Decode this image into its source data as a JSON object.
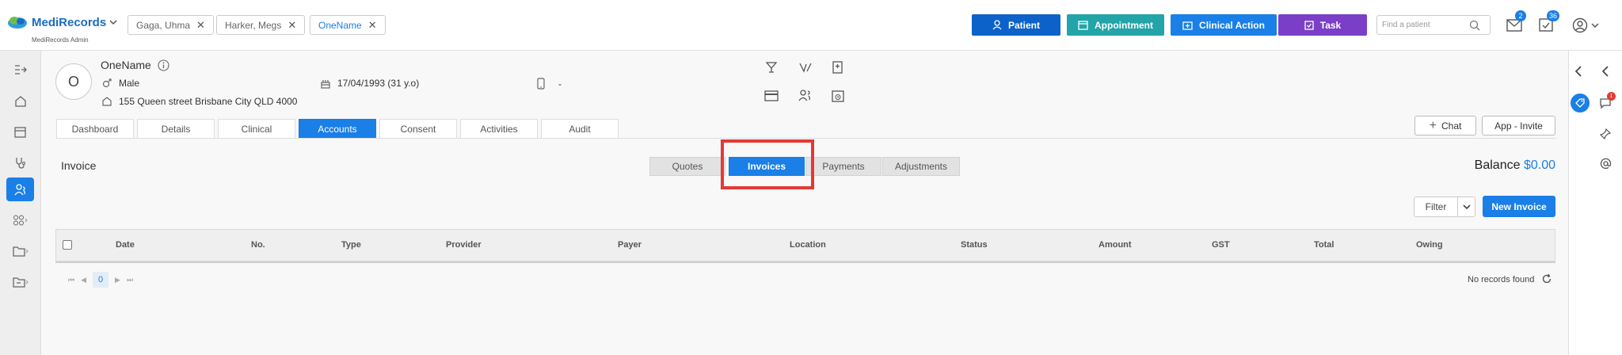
{
  "app": {
    "brand": "MediRecords",
    "subtitle": "MediRecords Admin",
    "colors": {
      "primary": "#1a7fe6",
      "patient": "#0d62c9",
      "appointment": "#22a4a8",
      "clinical": "#1a7fe6",
      "task": "#7b3fc7",
      "highlight": "#e53935"
    }
  },
  "open_patients": [
    {
      "label": "Gaga, Uhma"
    },
    {
      "label": "Harker, Megs"
    },
    {
      "label": "OneName"
    }
  ],
  "actions": {
    "patient": "Patient",
    "appointment": "Appointment",
    "clinical": "Clinical Action",
    "task": "Task"
  },
  "search": {
    "placeholder": "Find a patient"
  },
  "notifications": {
    "messages": "2",
    "tasks": "36",
    "right_badge": "1"
  },
  "patient": {
    "initial": "O",
    "name": "OneName",
    "gender": "Male",
    "dob": "17/04/1993 (31 y.o)",
    "address": "155 Queen street Brisbane City QLD 4000",
    "phone": "-"
  },
  "patient_tabs": [
    {
      "label": "Dashboard"
    },
    {
      "label": "Details"
    },
    {
      "label": "Clinical"
    },
    {
      "label": "Accounts"
    },
    {
      "label": "Consent"
    },
    {
      "label": "Activities"
    },
    {
      "label": "Audit"
    }
  ],
  "right_buttons": {
    "chat": "Chat",
    "app_invite": "App - Invite"
  },
  "accounts": {
    "section_title": "Invoice",
    "segments": [
      {
        "label": "Quotes"
      },
      {
        "label": "Invoices"
      },
      {
        "label": "Payments"
      },
      {
        "label": "Adjustments"
      }
    ],
    "active_segment": "Invoices",
    "balance_label": "Balance",
    "balance_value": "$0.00",
    "filter_label": "Filter",
    "new_invoice_label": "New Invoice",
    "columns": [
      "Date",
      "No.",
      "Type",
      "Provider",
      "Payer",
      "Location",
      "Status",
      "Amount",
      "GST",
      "Total",
      "Owing"
    ],
    "rows": [],
    "page": "0",
    "empty_text": "No records found"
  }
}
